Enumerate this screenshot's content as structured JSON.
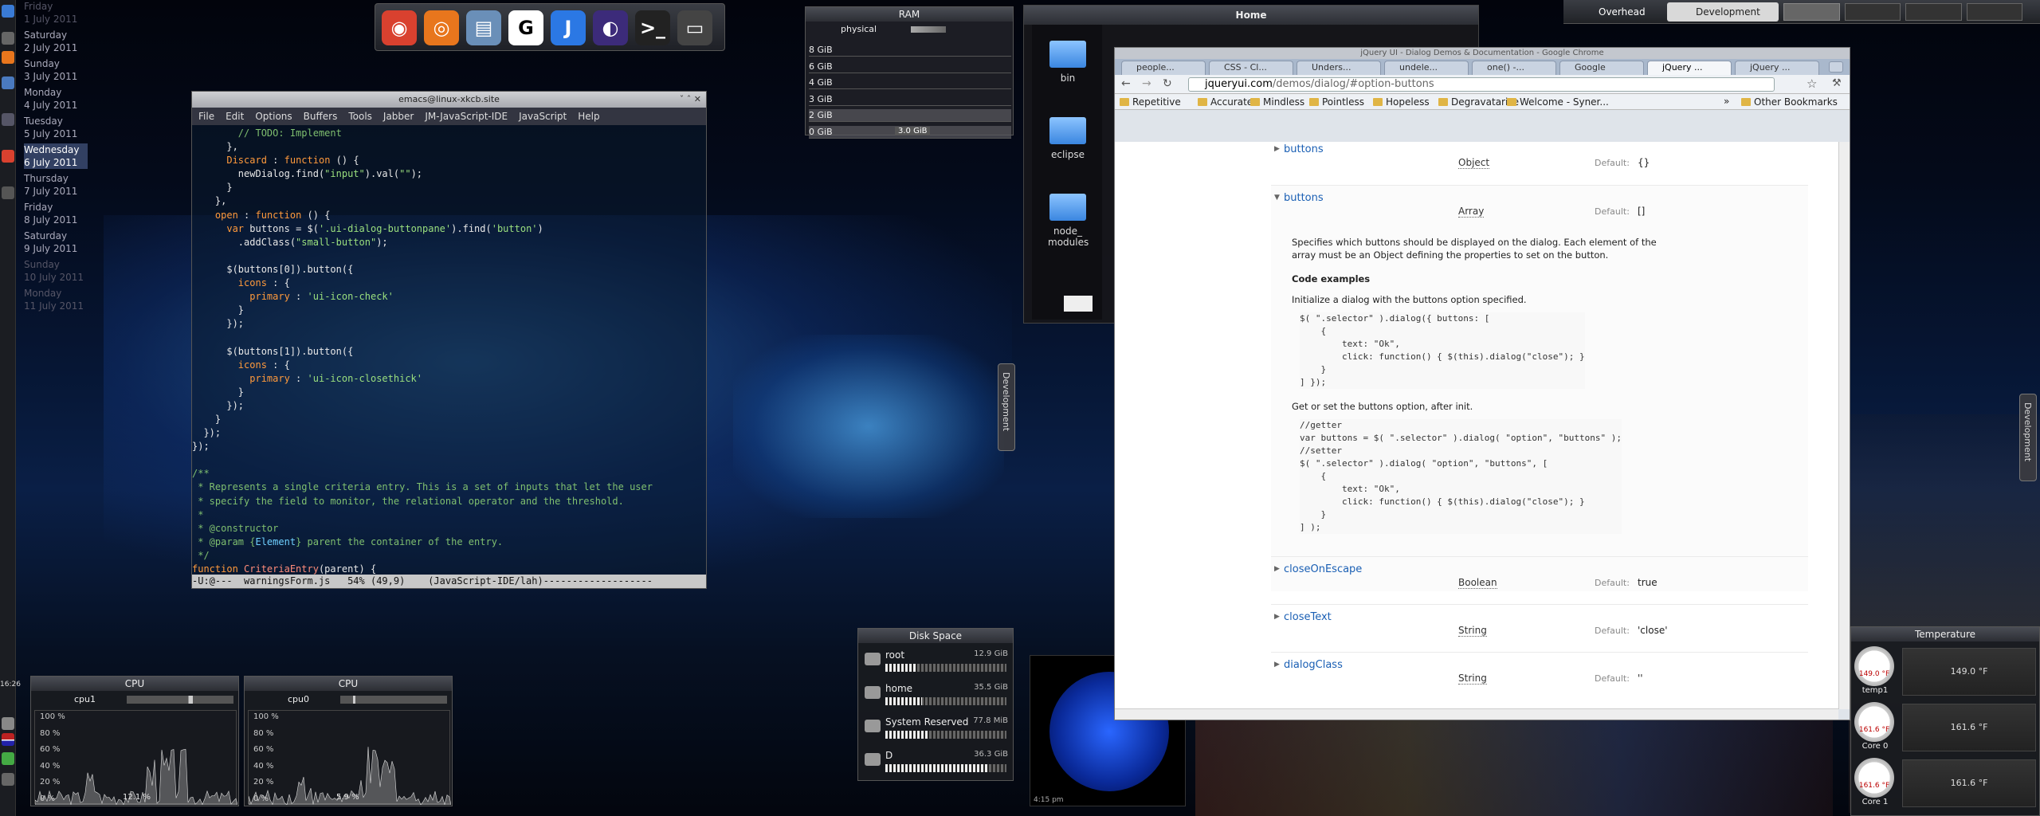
{
  "calendar": [
    {
      "day": "Friday",
      "date": "1 July 2011",
      "state": "dim"
    },
    {
      "day": "Saturday",
      "date": "2 July 2011",
      "state": ""
    },
    {
      "day": "Sunday",
      "date": "3 July 2011",
      "state": ""
    },
    {
      "day": "Monday",
      "date": "4 July 2011",
      "state": ""
    },
    {
      "day": "Tuesday",
      "date": "5 July 2011",
      "state": ""
    },
    {
      "day": "Wednesday",
      "date": "6 July 2011",
      "state": "today"
    },
    {
      "day": "Thursday",
      "date": "7 July 2011",
      "state": ""
    },
    {
      "day": "Friday",
      "date": "8 July 2011",
      "state": ""
    },
    {
      "day": "Saturday",
      "date": "9 July 2011",
      "state": ""
    },
    {
      "day": "Sunday",
      "date": "10 July 2011",
      "state": "dim"
    },
    {
      "day": "Monday",
      "date": "11 July 2011",
      "state": "dim"
    }
  ],
  "clock": "16:26",
  "dock": [
    {
      "name": "chrome-icon",
      "glyph": "◉",
      "color": "#d9412f"
    },
    {
      "name": "firefox-icon",
      "glyph": "◎",
      "color": "#e8761d"
    },
    {
      "name": "file-manager-icon",
      "glyph": "▤",
      "color": "#6a8fb8"
    },
    {
      "name": "g-icon",
      "glyph": "G",
      "color": "#ffffff"
    },
    {
      "name": "j-icon",
      "glyph": "J",
      "color": "#2b78e4"
    },
    {
      "name": "eclipse-icon",
      "glyph": "◐",
      "color": "#3c2b7a"
    },
    {
      "name": "terminal-icon",
      "glyph": ">_",
      "color": "#222222"
    },
    {
      "name": "monitor-icon",
      "glyph": "▭",
      "color": "#444444"
    }
  ],
  "emacs": {
    "title": "emacs@linux-xkcb.site",
    "menu": [
      "File",
      "Edit",
      "Options",
      "Buffers",
      "Tools",
      "Jabber",
      "JM-JavaScript-IDE",
      "JavaScript",
      "Help"
    ],
    "modeline": "-U:@---  warningsForm.js   54% (49,9)    (JavaScript-IDE/lah)-------------------"
  },
  "ram": {
    "title": "RAM",
    "physical_label": "physical",
    "rows": [
      "8 GiB",
      "6 GiB",
      "4 GiB",
      "3 GiB",
      "2 GiB",
      "0 GiB"
    ],
    "used": "3.0 GiB"
  },
  "cpus": [
    {
      "title": "CPU",
      "core": "cpu1",
      "value": "12.1 %"
    },
    {
      "title": "CPU",
      "core": "cpu0",
      "value": "5.9 %"
    }
  ],
  "cpu_scale": [
    "100 %",
    "80 %",
    "60 %",
    "40 %",
    "20 %",
    "0 %"
  ],
  "home": {
    "title": "Home",
    "folders": [
      "bin",
      "eclipse",
      "node_\nmodules"
    ]
  },
  "disk": {
    "title": "Disk Space",
    "rows": [
      {
        "name": "root",
        "size": "12.9 GiB",
        "fill": 0.25
      },
      {
        "name": "home",
        "size": "35.5 GiB",
        "fill": 0.3
      },
      {
        "name": "System Reserved",
        "size": "77.8 MiB",
        "fill": 0.35
      },
      {
        "name": "D",
        "size": "36.3 GiB",
        "fill": 0.85
      }
    ]
  },
  "sun_label": "4:15 pm",
  "chrome": {
    "title": "jQuery UI - Dialog Demos & Documentation - Google Chrome",
    "tabs": [
      "people...",
      "CSS - Cl...",
      "Unders...",
      "undele...",
      "one() -...",
      "Google",
      "jQuery ...",
      "jQuery ..."
    ],
    "active_tab": 6,
    "url_host": "jqueryui.com",
    "url_path": "/demos/dialog/#option-buttons",
    "bookmarks": [
      "Repetitive",
      "Accurate",
      "Mindless",
      "Pointless",
      "Hopeless",
      "Degravatarize",
      "Welcome - Syner..."
    ],
    "other_bookmarks": "Other Bookmarks"
  },
  "doc": {
    "default_label": "Default:",
    "options": [
      {
        "name": "buttons",
        "type": "Object",
        "default": "{}"
      },
      {
        "name": "buttons",
        "type": "Array",
        "default": "[]"
      },
      {
        "name": "closeOnEscape",
        "type": "Boolean",
        "default": "true"
      },
      {
        "name": "closeText",
        "type": "String",
        "default": "'close'"
      },
      {
        "name": "dialogClass",
        "type": "String",
        "default": "''"
      }
    ],
    "desc1": "Specifies which buttons should be displayed on the dialog. Each element of the",
    "desc2": "array must be an Object defining the properties to set on the button.",
    "code_examples": "Code examples",
    "init_text": "Initialize a dialog with the buttons option specified.",
    "init_code": "$( \".selector\" ).dialog({ buttons: [\n    {\n        text: \"Ok\",\n        click: function() { $(this).dialog(\"close\"); }\n    }\n] });",
    "getset_text": "Get or set the buttons option, after init.",
    "getset_code": "//getter\nvar buttons = $( \".selector\" ).dialog( \"option\", \"buttons\" );\n//setter\n$( \".selector\" ).dialog( \"option\", \"buttons\", [\n    {\n        text: \"Ok\",\n        click: function() { $(this).dialog(\"close\"); }\n    }\n] );"
  },
  "desktops": {
    "overhead": "Overhead",
    "development": "Development"
  },
  "side_tab": "Development",
  "temperature": {
    "title": "Temperature",
    "sensors": [
      {
        "name": "temp1",
        "value": "149.0 °F"
      },
      {
        "name": "Core 0",
        "value": "161.6 °F"
      },
      {
        "name": "Core 1",
        "value": "161.6 °F"
      }
    ]
  }
}
